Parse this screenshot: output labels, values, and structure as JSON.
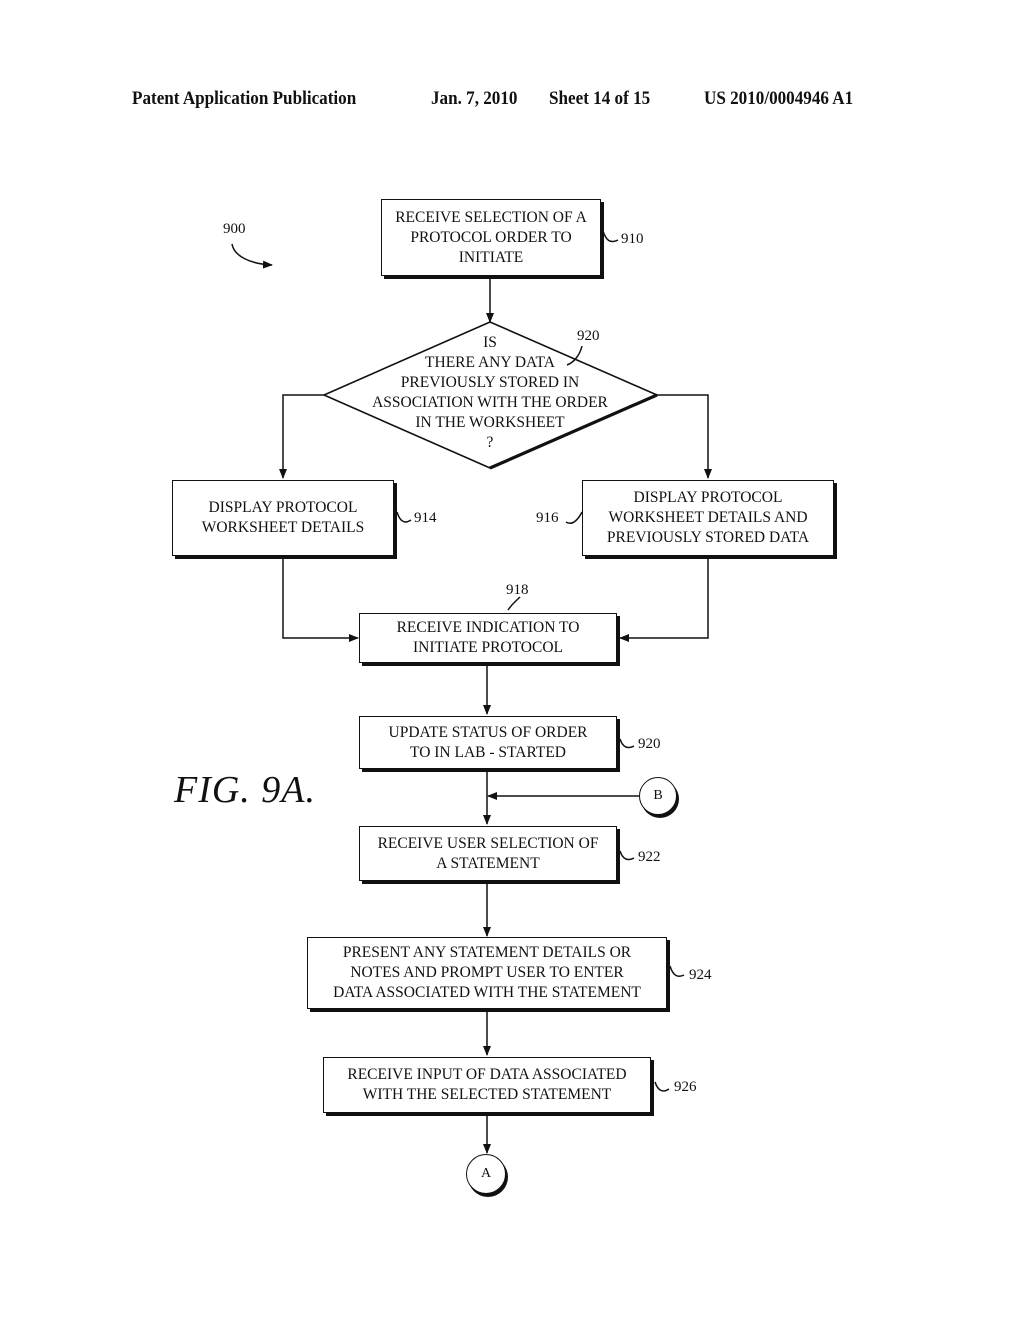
{
  "header": {
    "publication": "Patent Application Publication",
    "date": "Jan. 7, 2010",
    "sheet": "Sheet 14 of 15",
    "number": "US 2010/0004946 A1"
  },
  "figure": {
    "label": "FIG. 9A.",
    "ref": "900"
  },
  "steps": {
    "s910": {
      "text": "RECEIVE SELECTION OF A\nPROTOCOL ORDER TO\nINITIATE",
      "ref": "910"
    },
    "s920d": {
      "text": "IS\nTHERE ANY DATA\nPREVIOUSLY STORED IN\nASSOCIATION WITH THE ORDER\nIN THE WORKSHEET\n?",
      "ref": "920"
    },
    "s914": {
      "text": "DISPLAY PROTOCOL\nWORKSHEET DETAILS",
      "ref": "914"
    },
    "s916": {
      "text": "DISPLAY PROTOCOL\nWORKSHEET DETAILS AND\nPREVIOUSLY STORED DATA",
      "ref": "916"
    },
    "s918": {
      "text": "RECEIVE INDICATION TO\nINITIATE PROTOCOL",
      "ref": "918"
    },
    "s920": {
      "text": "UPDATE STATUS OF ORDER\nTO IN LAB - STARTED",
      "ref": "920"
    },
    "s922": {
      "text": "RECEIVE USER SELECTION OF\nA STATEMENT",
      "ref": "922"
    },
    "s924": {
      "text": "PRESENT ANY STATEMENT DETAILS OR\nNOTES AND PROMPT USER TO ENTER\nDATA ASSOCIATED WITH THE STATEMENT",
      "ref": "924"
    },
    "s926": {
      "text": "RECEIVE INPUT OF DATA ASSOCIATED\nWITH THE SELECTED STATEMENT",
      "ref": "926"
    }
  },
  "connectors": {
    "a": "A",
    "b": "B"
  }
}
